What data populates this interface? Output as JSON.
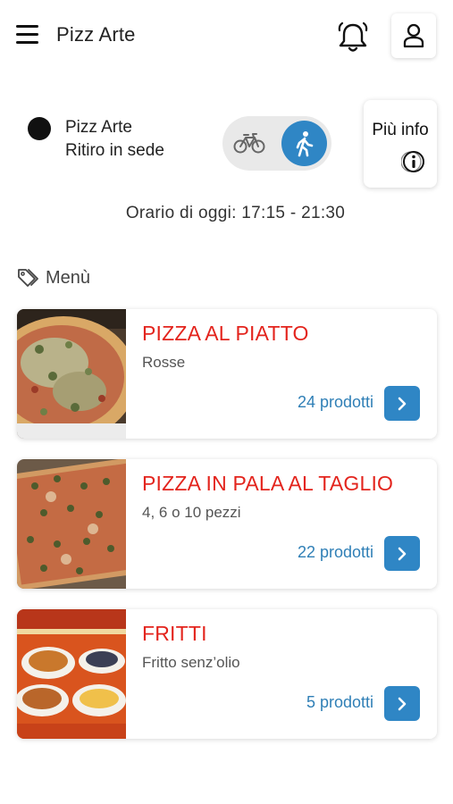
{
  "header": {
    "title": "Pizz Arte",
    "menu_icon": "hamburger-menu-icon",
    "bell_icon": "bell-icon",
    "user_icon": "user-icon"
  },
  "store": {
    "name": "Pizz Arte",
    "mode": "Ritiro in sede",
    "delivery_options": [
      "bike-icon",
      "walking-icon"
    ],
    "selected_option": "walking-icon",
    "info_label": "Più info",
    "hours": "Orario di oggi: 17:15 - 21:30"
  },
  "menu": {
    "heading": "Menù",
    "categories": [
      {
        "title": "PIZZA AL PIATTO",
        "subtitle": "Rosse",
        "count": "24 prodotti"
      },
      {
        "title": "PIZZA IN PALA AL TAGLIO",
        "subtitle": "4, 6 o 10 pezzi",
        "count": "22 prodotti"
      },
      {
        "title": "FRITTI",
        "subtitle": "Fritto senz’olio",
        "count": "5 prodotti"
      }
    ]
  },
  "colors": {
    "accent": "#2f86c5",
    "title_red": "#e3241d",
    "count_blue": "#2f7fb6"
  }
}
